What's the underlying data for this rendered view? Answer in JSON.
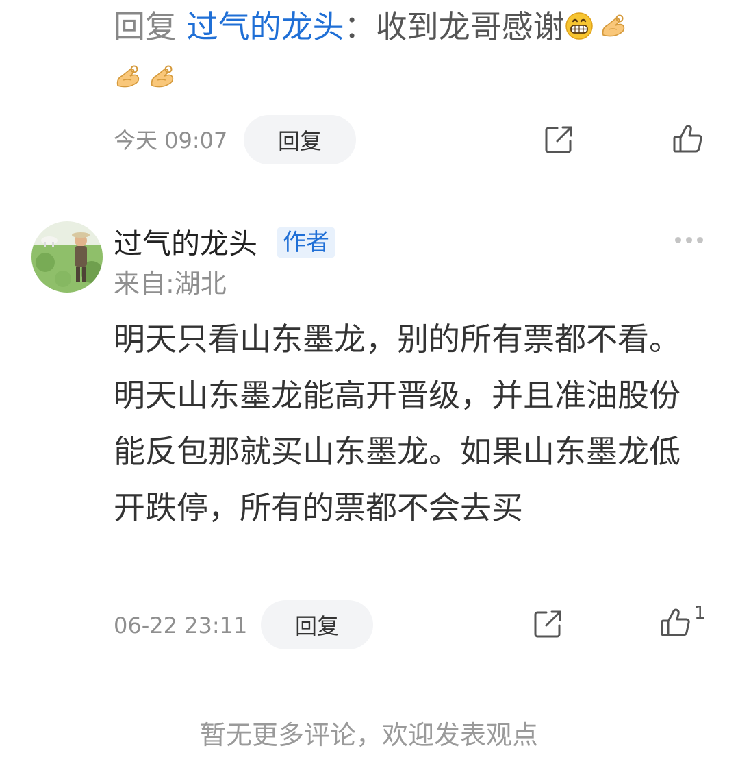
{
  "reply": {
    "prefix": "回复",
    "target_user": "过气的龙头",
    "separator": "：",
    "text": "收到龙哥感谢",
    "emojis": [
      "grin-emoji",
      "ok-hand-emoji",
      "ok-hand-emoji",
      "ok-hand-emoji"
    ],
    "time": "今天 09:07",
    "reply_button": "回复",
    "share_icon": "share-icon",
    "like_icon": "thumbs-up-icon"
  },
  "comment": {
    "username": "过气的龙头",
    "badge": "作者",
    "location": "来自:湖北",
    "body": "明天只看山东墨龙，别的所有票都不看。明天山东墨龙能高开晋级，并且准油股份能反包那就买山东墨龙。如果山东墨龙低开跌停，所有的票都不会去买",
    "time": "06-22 23:11",
    "reply_button": "回复",
    "like_count": "1",
    "more_icon": "more-dots-icon",
    "share_icon": "share-icon",
    "like_icon": "thumbs-up-icon"
  },
  "footer": {
    "no_more": "暂无更多评论，欢迎发表观点"
  },
  "colors": {
    "link": "#1f6fd6",
    "badge_bg": "#e8f1fc",
    "pill_bg": "#f3f4f6",
    "muted": "#8f8f8f"
  }
}
